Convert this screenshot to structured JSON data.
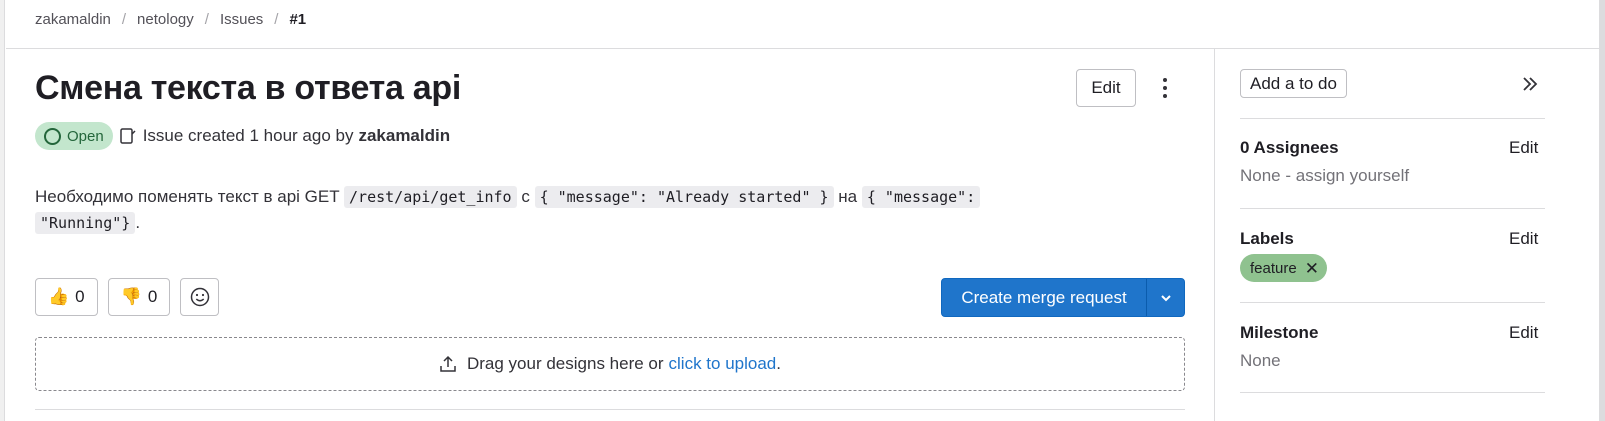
{
  "breadcrumb": {
    "items": [
      "zakamaldin",
      "netology",
      "Issues",
      "#1"
    ],
    "separator": "/"
  },
  "issue": {
    "title": "Смена текста в ответа api",
    "edit_label": "Edit",
    "status": "Open",
    "meta_text": "Issue created 1 hour ago by",
    "author": "zakamaldin",
    "description": {
      "part1": "Необходимо поменять текст в api GET",
      "code1": "/rest/api/get_info",
      "part2": "с",
      "code2": "{ \"message\": \"Already started\" }",
      "part3": "на",
      "code3a": "{ \"message\":",
      "code3b": "\"Running\"}",
      "part4": "."
    }
  },
  "reactions": {
    "thumbs_up": {
      "emoji": "👍",
      "count": "0"
    },
    "thumbs_down": {
      "emoji": "👎",
      "count": "0"
    }
  },
  "merge_request": {
    "label": "Create merge request"
  },
  "dropzone": {
    "text": "Drag your designs here or",
    "link": "click to upload",
    "suffix": "."
  },
  "sidebar": {
    "todo_label": "Add a to do",
    "assignees": {
      "title": "0 Assignees",
      "edit": "Edit",
      "value": "None - assign yourself"
    },
    "labels": {
      "title": "Labels",
      "edit": "Edit",
      "items": [
        "feature"
      ],
      "label_color": "#8fc28f"
    },
    "milestone": {
      "title": "Milestone",
      "edit": "Edit",
      "value": "None"
    }
  },
  "colors": {
    "primary": "#1f75cb",
    "status_open_bg": "#c3e6cd",
    "status_open_fg": "#24663b"
  },
  "icons": [
    "kebab-icon",
    "open-status-icon",
    "issue-note-icon",
    "smile-icon",
    "chevron-down-icon",
    "upload-icon",
    "collapse-sidebar-icon",
    "close-icon"
  ]
}
